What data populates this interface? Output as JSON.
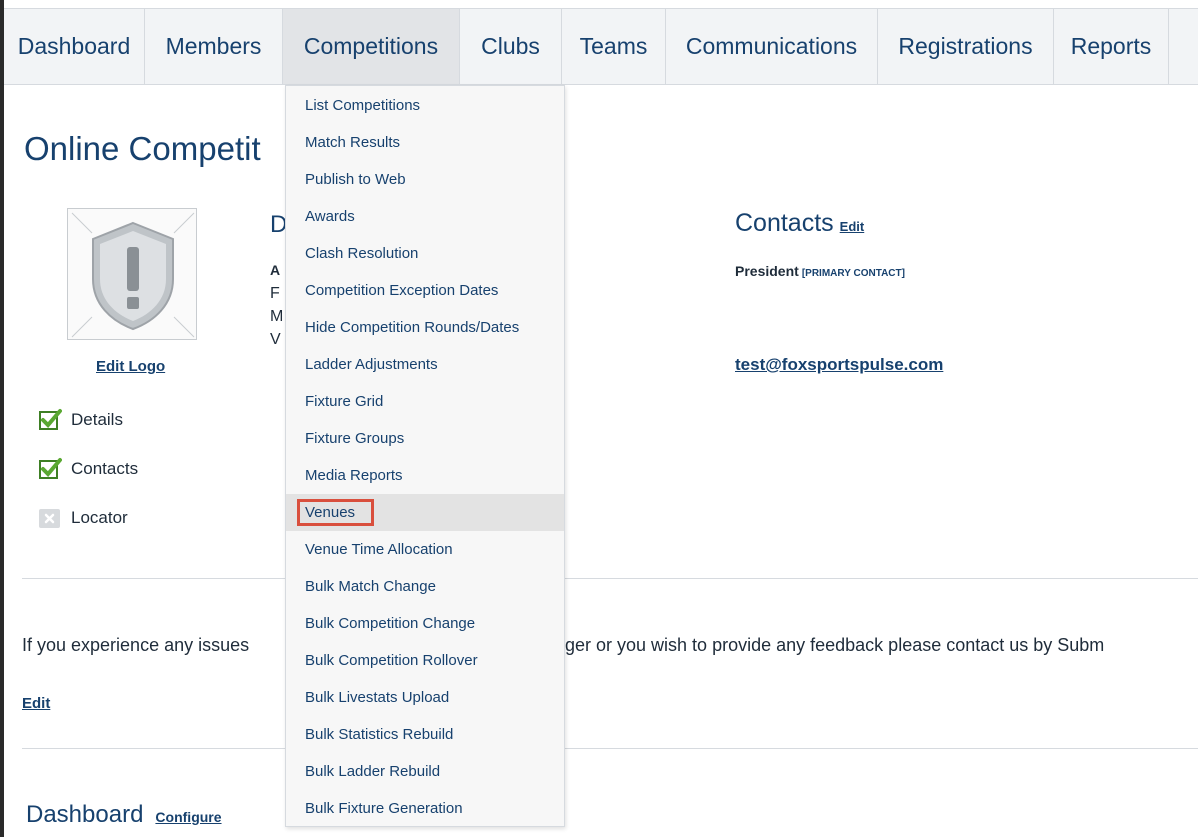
{
  "nav": {
    "items": [
      {
        "label": "Dashboard"
      },
      {
        "label": "Members"
      },
      {
        "label": "Competitions"
      },
      {
        "label": "Clubs"
      },
      {
        "label": "Teams"
      },
      {
        "label": "Communications"
      },
      {
        "label": "Registrations"
      },
      {
        "label": "Reports"
      }
    ],
    "active": "Competitions"
  },
  "page": {
    "title_visible": "Online Competit",
    "edit_logo": "Edit Logo",
    "checklist": [
      {
        "label": "Details",
        "status": "checked"
      },
      {
        "label": "Contacts",
        "status": "checked"
      },
      {
        "label": "Locator",
        "status": "unchecked"
      }
    ],
    "partial_column": {
      "heading_letter": "D",
      "letters": [
        "A",
        "F",
        "M",
        "V"
      ]
    }
  },
  "contacts": {
    "title": "Contacts",
    "edit": "Edit",
    "role": "President",
    "role_tag": "[PRIMARY CONTACT]",
    "email": "test@foxsportspulse.com"
  },
  "footer": {
    "issues_left": "If you experience any issues",
    "issues_right": "ger or you wish to provide any feedback please contact us by Subm",
    "edit": "Edit",
    "dashboard_title": "Dashboard",
    "configure": "Configure"
  },
  "dropdown": {
    "items": [
      {
        "label": "List Competitions"
      },
      {
        "label": "Match Results"
      },
      {
        "label": "Publish to Web"
      },
      {
        "label": "Awards"
      },
      {
        "label": "Clash Resolution"
      },
      {
        "label": "Competition Exception Dates"
      },
      {
        "label": "Hide Competition Rounds/Dates"
      },
      {
        "label": "Ladder Adjustments"
      },
      {
        "label": "Fixture Grid"
      },
      {
        "label": "Fixture Groups"
      },
      {
        "label": "Media Reports"
      },
      {
        "label": "Venues"
      },
      {
        "label": "Venue Time Allocation"
      },
      {
        "label": "Bulk Match Change"
      },
      {
        "label": "Bulk Competition Change"
      },
      {
        "label": "Bulk Competition Rollover"
      },
      {
        "label": "Bulk Livestats Upload"
      },
      {
        "label": "Bulk Statistics Rebuild"
      },
      {
        "label": "Bulk Ladder Rebuild"
      },
      {
        "label": "Bulk Fixture Generation"
      }
    ],
    "selected": "Venues"
  },
  "colors": {
    "link": "#17416e",
    "highlight": "#d94f3d",
    "check_green": "#5aa832"
  },
  "icons": {
    "logo_placeholder": "warning-shield-icon",
    "checked": "checkbox-checked-icon",
    "unchecked": "checkbox-x-icon"
  }
}
